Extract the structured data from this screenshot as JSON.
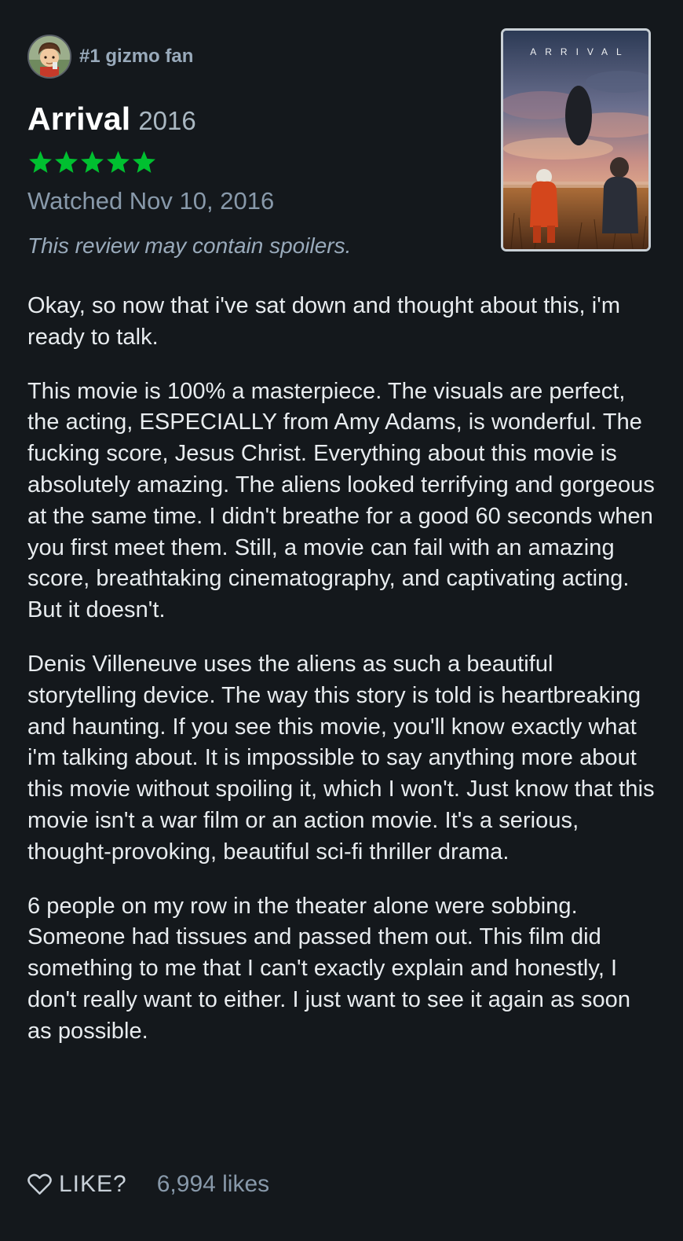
{
  "reviewer": {
    "name": "#1 gizmo fan"
  },
  "film": {
    "title": "Arrival",
    "year": "2016",
    "rating_stars": 5,
    "star_color": "#00c030",
    "poster_title": "ARRIVAL"
  },
  "watched_text": "Watched Nov 10, 2016",
  "spoiler_notice": "This review may contain spoilers.",
  "review_paragraphs": [
    "Okay, so now that i've sat down and thought about this, i'm ready to talk.",
    "This movie is 100% a masterpiece. The visuals are perfect, the acting, ESPECIALLY from Amy Adams, is wonderful. The fucking score, Jesus Christ. Everything about this movie is absolutely amazing. The aliens looked terrifying and gorgeous at the same time. I didn't breathe for a good 60 seconds when you first meet them. Still, a movie can fail with an amazing score, breathtaking cinematography, and captivating acting. But it doesn't.",
    "Denis Villeneuve uses the aliens as such a beautiful storytelling device. The way this story is told is heartbreaking and haunting. If you see this movie, you'll know exactly what i'm talking about. It is impossible to say anything more about this movie without spoiling it, which I won't. Just know that this movie isn't a war film or an action movie. It's a serious, thought-provoking, beautiful sci-fi thriller drama.",
    "6 people on my row in the theater alone were sobbing. Someone had tissues and passed them out. This film did something to me that I can't exactly explain and honestly, I don't really want to either. I just want to see it again as soon as possible."
  ],
  "footer": {
    "like_label": "LIKE?",
    "likes_count": "6,994 likes"
  },
  "colors": {
    "background": "#14181c",
    "accent_green": "#00c030"
  }
}
